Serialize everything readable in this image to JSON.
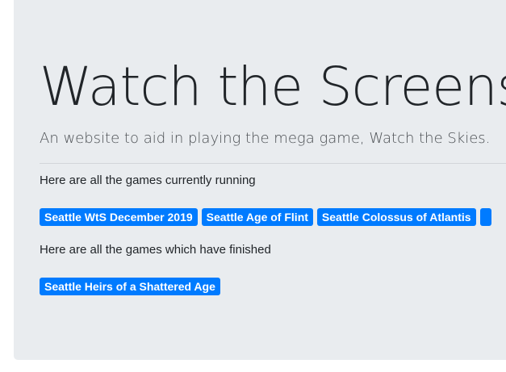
{
  "header": {
    "title": "Watch the Screens!",
    "lead": "An website to aid in playing the mega game, Watch the Skies."
  },
  "running": {
    "intro": "Here are all the games currently running",
    "games": [
      "Seattle WtS December 2019",
      "Seattle Age of Flint",
      "Seattle Colossus of Atlantis",
      ""
    ]
  },
  "finished": {
    "intro": "Here are all the games which have finished",
    "games": [
      "Seattle Heirs of a Shattered Age"
    ]
  },
  "colors": {
    "jumbotron_bg": "#e9ecef",
    "badge_bg": "#007bff",
    "badge_text": "#ffffff"
  }
}
